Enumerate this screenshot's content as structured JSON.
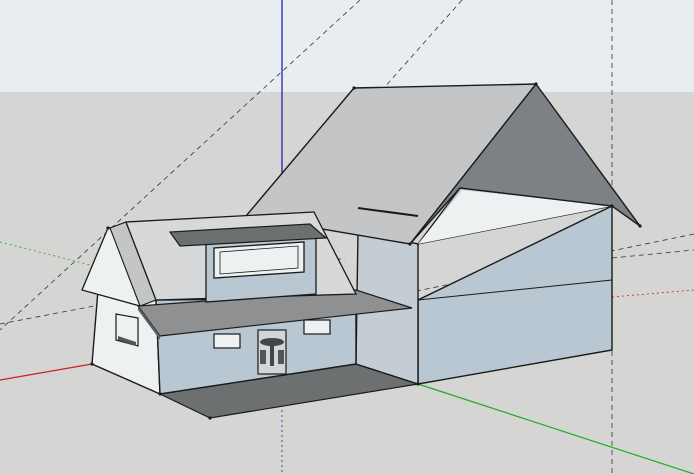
{
  "app": {
    "viewport_label": ""
  },
  "colors": {
    "sky": "#e8eef0",
    "ground": "#d5d5d3",
    "axis_red": "#cc2222",
    "axis_green": "#22aa22",
    "axis_blue": "#2222bb",
    "roof_light": "#c4c5c6",
    "roof_dark": "#7c8185",
    "wall_blue": "#b9c7d2",
    "wall_white": "#eef1f2",
    "porch_floor": "#6d7071",
    "canopy": "#8e9091",
    "edge": "#1a1a1a"
  }
}
